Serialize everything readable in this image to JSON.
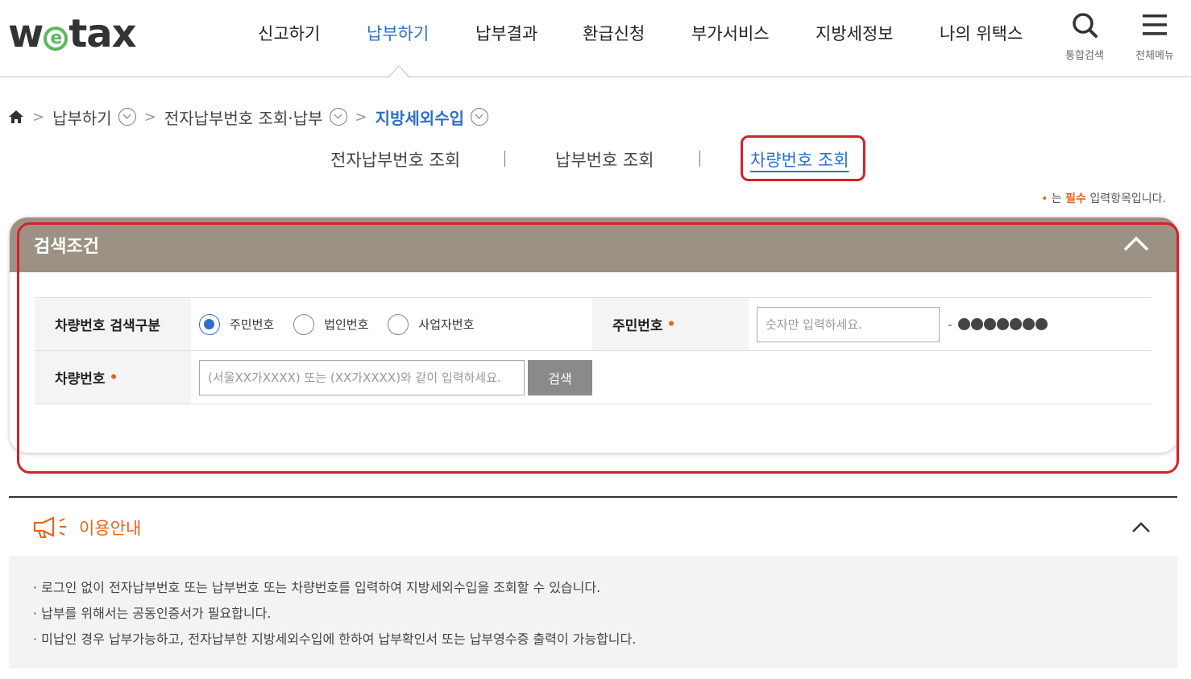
{
  "header": {
    "logo": "wetax",
    "menu": [
      "신고하기",
      "납부하기",
      "납부결과",
      "환급신청",
      "부가서비스",
      "지방세정보",
      "나의 위택스"
    ],
    "active_menu_index": 1,
    "search_label": "통합검색",
    "menu_label": "전체메뉴"
  },
  "breadcrumb": {
    "items": [
      "납부하기",
      "전자납부번호 조회·납부",
      "지방세외수입"
    ]
  },
  "tabs": [
    "전자납부번호 조회",
    "납부번호 조회",
    "차량번호 조회"
  ],
  "active_tab_index": 2,
  "required_note": {
    "dot": "•",
    "prefix": "는",
    "keyword": "필수",
    "suffix": "입력항목입니다."
  },
  "search_panel": {
    "title": "검색조건",
    "rows": {
      "type_label": "차량번호 검색구분",
      "radios": [
        {
          "label": "주민번호",
          "checked": true
        },
        {
          "label": "법인번호",
          "checked": false
        },
        {
          "label": "사업자번호",
          "checked": false
        }
      ],
      "id_label": "주민번호",
      "id_placeholder": "숫자만 입력하세요.",
      "id_mask_dash": "-",
      "car_label": "차량번호",
      "car_placeholder": "(서울XX가XXXX) 또는 (XX가XXXX)와 같이 입력하세요.",
      "search_button": "검색",
      "required_dot": "•"
    }
  },
  "info": {
    "title": "이용안내",
    "lines": [
      "· 로그인 없이 전자납부번호 또는 납부번호 또는 차량번호를 입력하여 지방세외수입을 조회할 수 있습니다.",
      "· 납부를 위해서는 공동인증서가 필요합니다.",
      "· 미납인 경우 납부가능하고, 전자납부한 지방세외수입에 한하여 납부확인서 또는 납부영수증 출력이 가능합니다."
    ]
  },
  "colors": {
    "accent": "#2d6fc6",
    "panel_header": "#9c9283",
    "highlight_box": "#d6202a",
    "required": "#e8641b"
  }
}
